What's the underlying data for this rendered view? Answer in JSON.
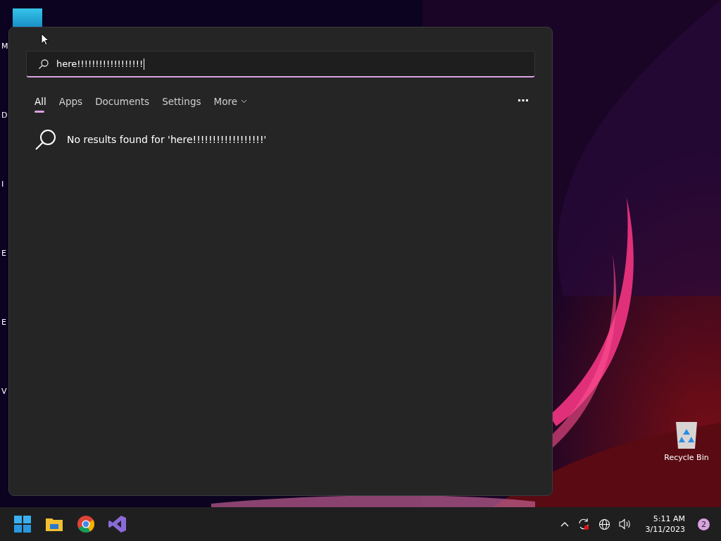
{
  "desktop_icons": [
    {
      "label": "M"
    },
    {
      "label": "D"
    },
    {
      "label": "I"
    },
    {
      "label": "E"
    },
    {
      "label": "E"
    },
    {
      "label": "V"
    },
    {
      "label": "Recycle Bin"
    }
  ],
  "search": {
    "value": "here!!!!!!!!!!!!!!!!!!"
  },
  "tabs": [
    {
      "label": "All",
      "selected": true
    },
    {
      "label": "Apps",
      "selected": false
    },
    {
      "label": "Documents",
      "selected": false
    },
    {
      "label": "Settings",
      "selected": false
    },
    {
      "label": "More",
      "selected": false,
      "dropdown": true
    }
  ],
  "message": "No results found for 'here!!!!!!!!!!!!!!!!!!'",
  "taskbar": {
    "time": "5:11 AM",
    "date": "3/11/2023",
    "notifications": "2"
  }
}
